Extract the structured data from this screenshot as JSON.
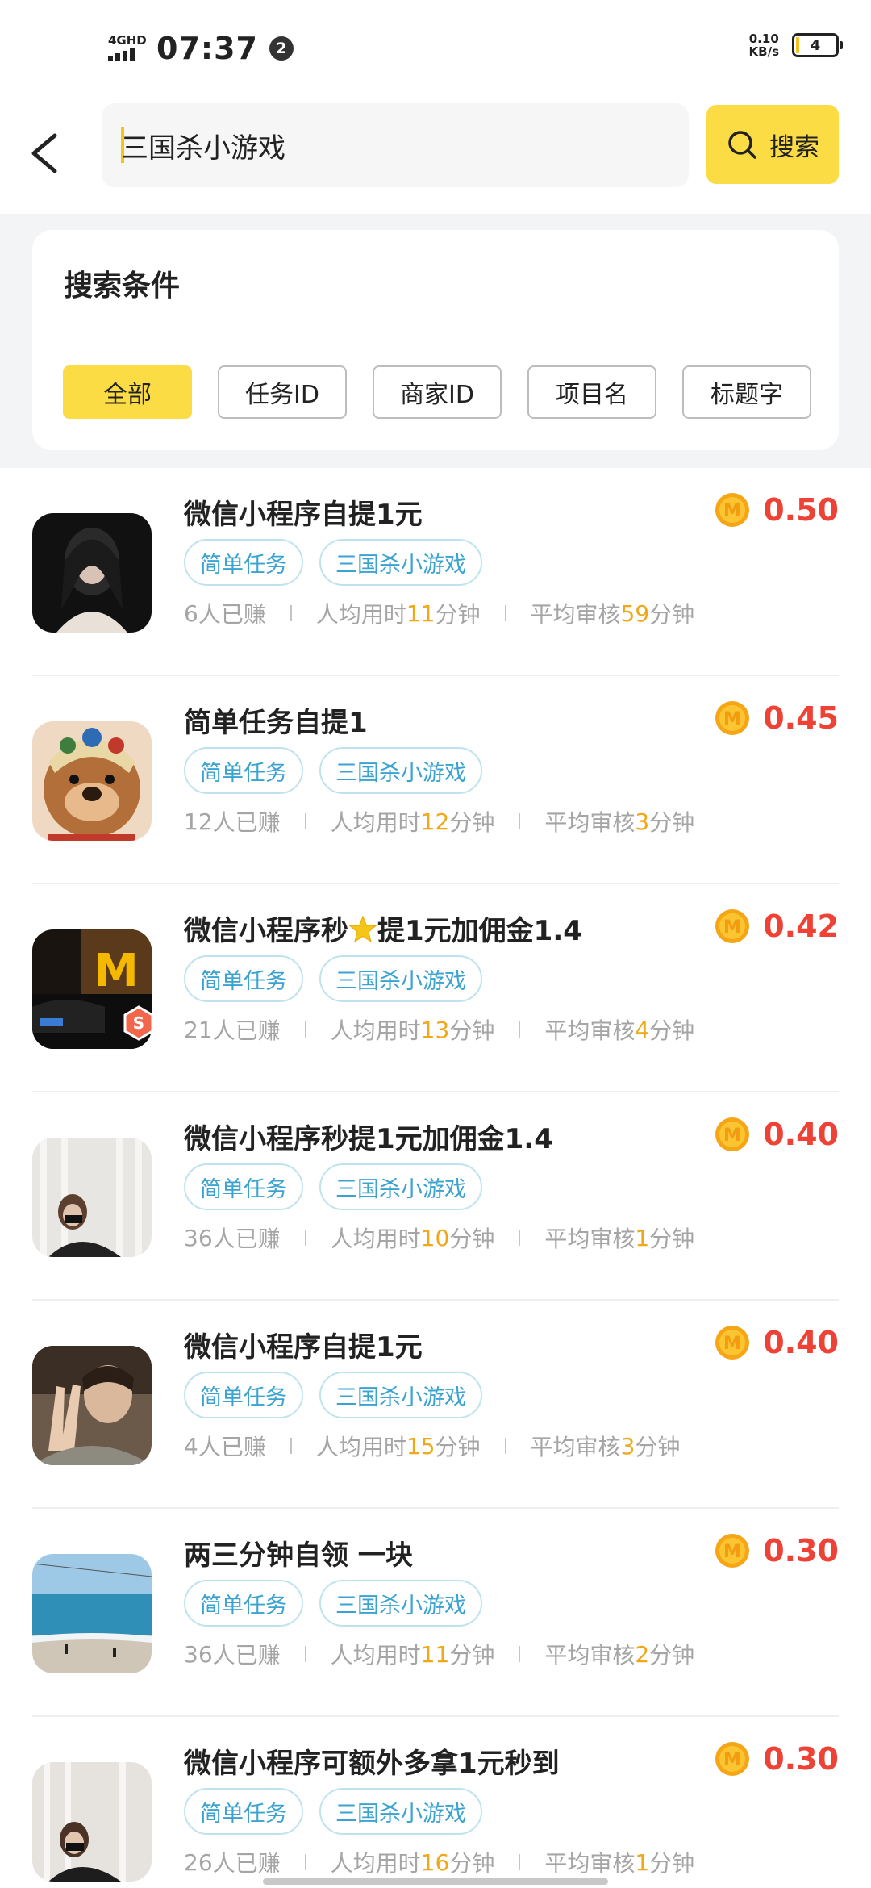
{
  "status_bar": {
    "network": "4GHD",
    "time": "07:37",
    "notification_count": "2",
    "speed_value": "0.10",
    "speed_unit": "KB/s",
    "battery": "4"
  },
  "search": {
    "query": "三国杀小游戏",
    "button_label": "搜索"
  },
  "filter": {
    "title": "搜索条件",
    "chips": [
      "全部",
      "任务ID",
      "商家ID",
      "项目名",
      "标题字"
    ],
    "active_chip": "全部"
  },
  "colors": {
    "accent_yellow": "#fbdc45",
    "price_red": "#ef4236",
    "tag_blue": "#3ba3d0",
    "highlight_orange": "#f0a818"
  },
  "tasks": [
    {
      "title": "微信小程序自提1元",
      "reward": "0.50",
      "tags": [
        "简单任务",
        "三国杀小游戏"
      ],
      "earned_prefix": "6",
      "earned_suffix": "人已赚",
      "time_label": "人均用时",
      "time_value": "11",
      "time_unit": "分钟",
      "review_label": "平均审核",
      "review_value": "59",
      "review_unit": "分钟",
      "thumb": "photo-woman-dark"
    },
    {
      "title": "简单任务自提1",
      "reward": "0.45",
      "tags": [
        "简单任务",
        "三国杀小游戏"
      ],
      "earned_prefix": "12",
      "earned_suffix": "人已赚",
      "time_label": "人均用时",
      "time_value": "12",
      "time_unit": "分钟",
      "review_label": "平均审核",
      "review_value": "3",
      "review_unit": "分钟",
      "thumb": "photo-bear-mascot"
    },
    {
      "title_part1": "微信小程序秒",
      "title_part2": "提1元加佣金1.4",
      "title_icon": "star-icon",
      "reward": "0.42",
      "tags": [
        "简单任务",
        "三国杀小游戏"
      ],
      "earned_prefix": "21",
      "earned_suffix": "人已赚",
      "time_label": "人均用时",
      "time_value": "13",
      "time_unit": "分钟",
      "review_label": "平均审核",
      "review_value": "4",
      "review_unit": "分钟",
      "thumb": "photo-night-street",
      "badge": "S"
    },
    {
      "title": "微信小程序秒提1元加佣金1.4",
      "reward": "0.40",
      "tags": [
        "简单任务",
        "三国杀小游戏"
      ],
      "earned_prefix": "36",
      "earned_suffix": "人已赚",
      "time_label": "人均用时",
      "time_value": "10",
      "time_unit": "分钟",
      "review_label": "平均审核",
      "review_value": "1",
      "review_unit": "分钟",
      "thumb": "photo-woman-curtain"
    },
    {
      "title": "微信小程序自提1元",
      "reward": "0.40",
      "tags": [
        "简单任务",
        "三国杀小游戏"
      ],
      "earned_prefix": "4",
      "earned_suffix": "人已赚",
      "time_label": "人均用时",
      "time_value": "15",
      "time_unit": "分钟",
      "review_label": "平均审核",
      "review_value": "3",
      "review_unit": "分钟",
      "thumb": "photo-peace-sign"
    },
    {
      "title": "两三分钟自领 一块",
      "reward": "0.30",
      "tags": [
        "简单任务",
        "三国杀小游戏"
      ],
      "earned_prefix": "36",
      "earned_suffix": "人已赚",
      "time_label": "人均用时",
      "time_value": "11",
      "time_unit": "分钟",
      "review_label": "平均审核",
      "review_value": "2",
      "review_unit": "分钟",
      "thumb": "photo-beach"
    },
    {
      "title": "微信小程序可额外多拿1元秒到",
      "reward": "0.30",
      "tags": [
        "简单任务",
        "三国杀小游戏"
      ],
      "earned_prefix": "26",
      "earned_suffix": "人已赚",
      "time_label": "人均用时",
      "time_value": "16",
      "time_unit": "分钟",
      "review_label": "平均审核",
      "review_value": "1",
      "review_unit": "分钟",
      "thumb": "photo-woman-curtain-2"
    }
  ]
}
